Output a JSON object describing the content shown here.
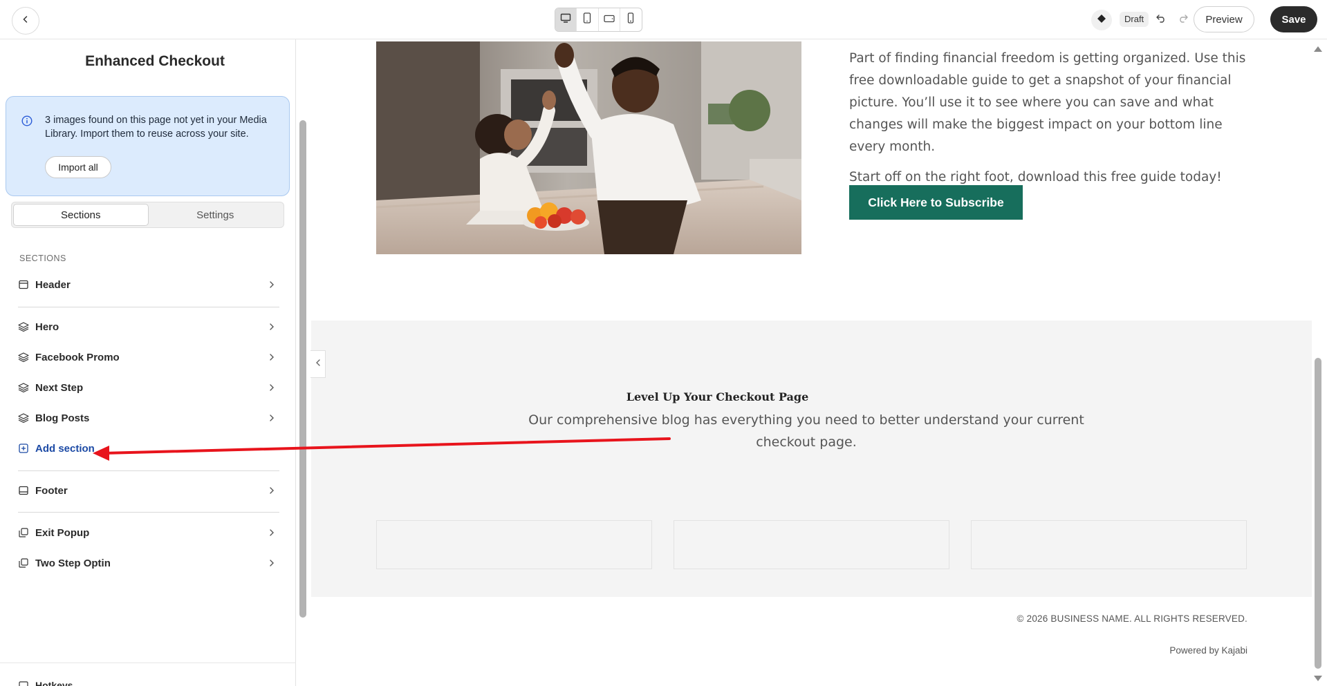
{
  "topbar": {
    "back_icon": "chevron-left-icon",
    "devices": [
      "desktop-icon",
      "tablet-portrait-icon",
      "tablet-landscape-icon",
      "mobile-icon"
    ],
    "active_device": "desktop",
    "status": "Draft",
    "preview_label": "Preview",
    "save_label": "Save"
  },
  "sidebar": {
    "title": "Enhanced Checkout",
    "info": {
      "text": "3 images found on this page not yet in your Media Library. Import them to reuse across your site.",
      "button": "Import all"
    },
    "tabs": [
      {
        "label": "Sections",
        "active": true
      },
      {
        "label": "Settings",
        "active": false
      }
    ],
    "sections_heading": "SECTIONS",
    "items": [
      {
        "label": "Header",
        "icon": "header-layout-icon"
      },
      {
        "label": "Hero",
        "icon": "layers-icon"
      },
      {
        "label": "Facebook Promo",
        "icon": "layers-icon"
      },
      {
        "label": "Next Step",
        "icon": "layers-icon"
      },
      {
        "label": "Blog Posts",
        "icon": "layers-icon"
      },
      {
        "label": "Add section",
        "icon": "plus-square-icon"
      },
      {
        "label": "Footer",
        "icon": "footer-layout-icon"
      },
      {
        "label": "Exit Popup",
        "icon": "popup-icon"
      },
      {
        "label": "Two Step Optin",
        "icon": "popup-icon"
      }
    ],
    "hotkeys_label": "Hotkeys"
  },
  "preview": {
    "hero": {
      "paragraph1": "Part of finding financial freedom is getting organized. Use this free downloadable guide to get a snapshot of your financial picture. You’ll use it to see where you can save and what changes will make the biggest impact on your bottom line every month.",
      "paragraph2": "Start off on the right foot, download this free guide today!",
      "button": "Click Here to Subscribe",
      "button_color": "#176e5c"
    },
    "blog": {
      "title": "Level Up Your Checkout Page",
      "subtitle": "Our comprehensive blog has everything you need to better understand your current checkout page."
    },
    "footer": {
      "copyright": "© 2026 BUSINESS NAME. ALL RIGHTS RESERVED.",
      "powered": "Powered by Kajabi"
    }
  },
  "colors": {
    "accent": "#176e5c",
    "info_bg": "#dcebfd",
    "annotation_arrow": "#e8141c",
    "link": "#1c4aa5"
  }
}
